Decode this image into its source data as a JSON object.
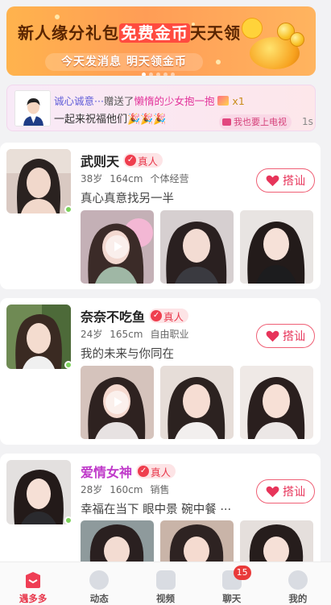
{
  "banner": {
    "title_part1": "新人缘分礼包",
    "title_highlight": "免费金币",
    "title_part2": "天天领",
    "subtitle": "今天发消息  明天领金币",
    "page_indicator": {
      "count": 5,
      "active": 1
    }
  },
  "gift_notice": {
    "sender": "诚心诚意···",
    "action_text": "赠送了",
    "target": "懒惰的少女抱一抱",
    "count": "x1",
    "line2": "一起来祝福他们🎉🎉🎉",
    "tv_button": "我也要上电视",
    "timer": "1s"
  },
  "greet_label": "搭讪",
  "verified_label": "真人",
  "profiles": [
    {
      "name": "武则天",
      "vip": false,
      "age": "38岁",
      "height": "164cm",
      "job": "个体经营",
      "bio": "真心真意找另一半",
      "online": true,
      "photo_count": 3,
      "first_is_video": true
    },
    {
      "name": "奈奈不吃鱼",
      "vip": false,
      "age": "24岁",
      "height": "165cm",
      "job": "自由职业",
      "bio": "我的未来与你同在",
      "online": true,
      "photo_count": 3,
      "first_is_video": true
    },
    {
      "name": "爱情女神",
      "vip": true,
      "age": "28岁",
      "height": "160cm",
      "job": "销售",
      "bio": "幸福在当下 眼中景 碗中餐 ···",
      "online": true,
      "photo_count": 3,
      "first_is_video": false
    }
  ],
  "tabbar": [
    {
      "label": "遇多多",
      "icon": "home-icon",
      "active": true
    },
    {
      "label": "动态",
      "icon": "moments-icon",
      "active": false
    },
    {
      "label": "视频",
      "icon": "video-icon",
      "active": false
    },
    {
      "label": "聊天",
      "icon": "chat-icon",
      "active": false,
      "badge": "15"
    },
    {
      "label": "我的",
      "icon": "profile-icon",
      "active": false
    }
  ],
  "colors": {
    "accent": "#e8374b",
    "vip_name": "#bf39c9",
    "online": "#7dd25d",
    "banner": "#ffa154"
  }
}
